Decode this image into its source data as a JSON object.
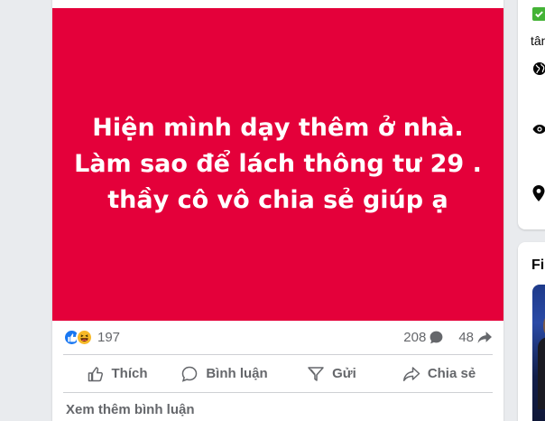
{
  "post": {
    "image_lines": [
      "Hiện mình dạy thêm ở nhà.",
      "Làm sao để lách thông tư 29 .",
      "thầy cô vô chia sẻ giúp ạ"
    ],
    "background_color": "#e4003a",
    "reactions": {
      "icons": [
        "like-reaction-icon",
        "haha-reaction-icon"
      ],
      "count": "197"
    },
    "comments_count": "208",
    "shares_count": "48"
  },
  "actions": {
    "like_label": "Thích",
    "comment_label": "Bình luận",
    "send_label": "Gửi",
    "share_label": "Chia sẻ"
  },
  "more_comments_label": "Xem thêm bình luận",
  "right_panel": {
    "partial_text": "tân",
    "partial_title": "Fil"
  },
  "colors": {
    "like_blue": "#1877f2",
    "haha_yellow": "#f7b928",
    "muted_text": "#65676b",
    "verified_green": "#44b336"
  }
}
